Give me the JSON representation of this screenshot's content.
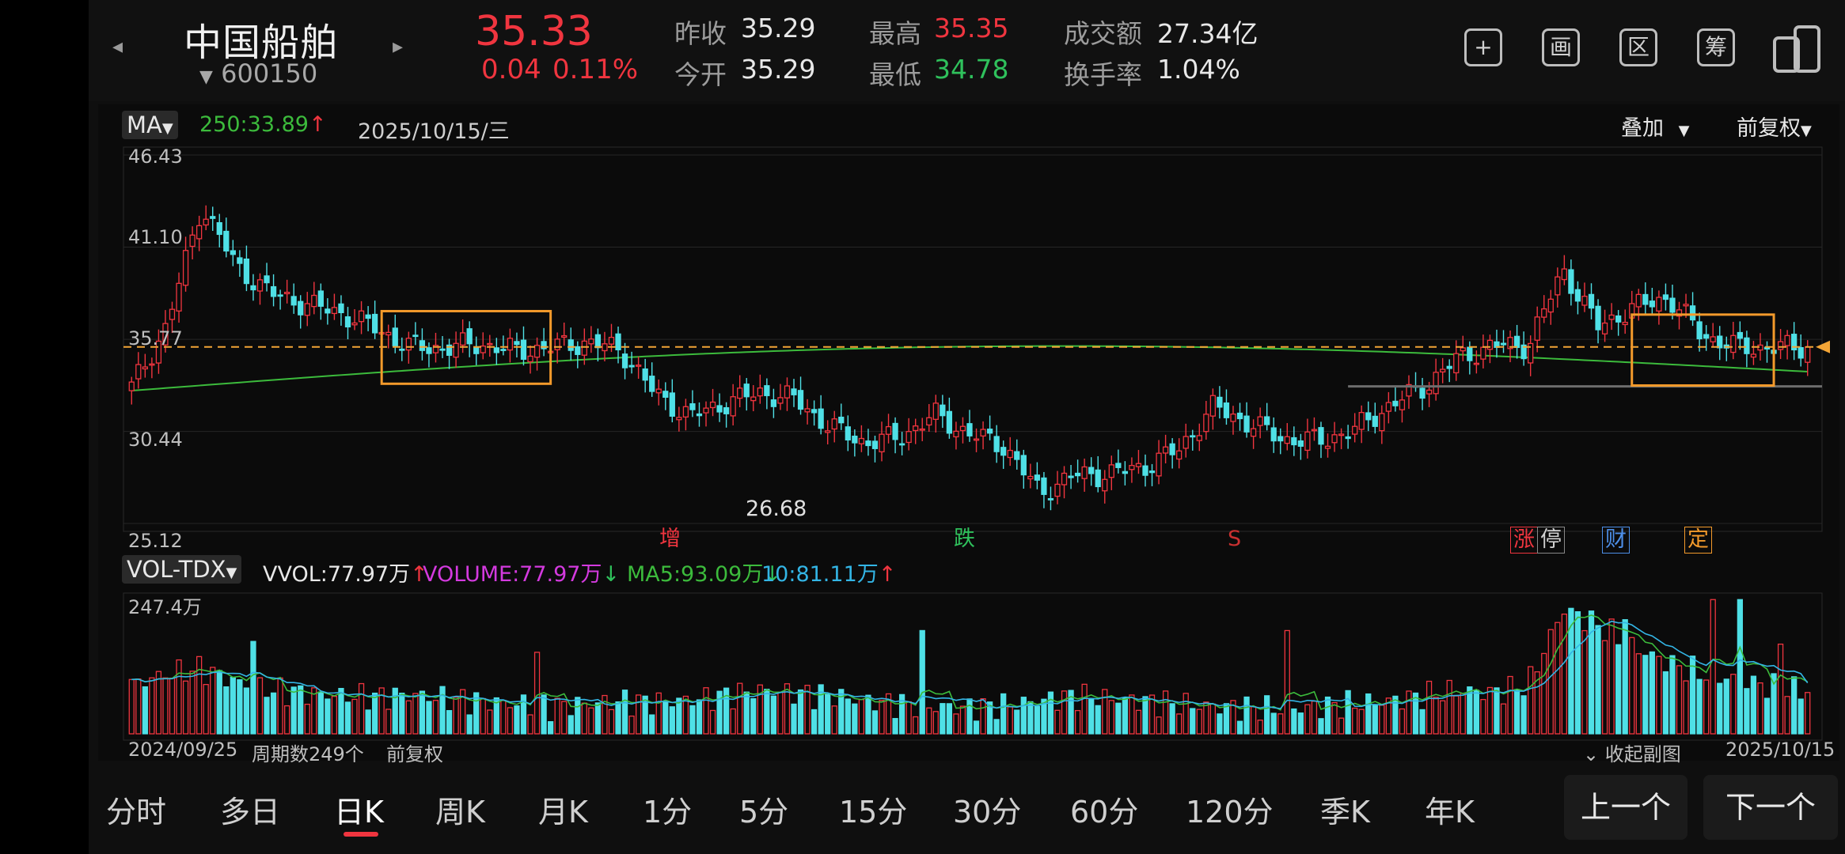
{
  "header": {
    "stock_name": "中国船舶",
    "stock_code": "600150",
    "price": "35.33",
    "change": "0.04",
    "change_pct": "0.11%",
    "prev_close_label": "昨收",
    "prev_close": "35.29",
    "open_label": "今开",
    "open": "35.29",
    "high_label": "最高",
    "high": "35.35",
    "low_label": "最低",
    "low": "34.78",
    "turnover_amount_label": "成交额",
    "turnover_amount": "27.34亿",
    "turnover_rate_label": "换手率",
    "turnover_rate": "1.04%"
  },
  "toolbar": {
    "icons": [
      "plus-icon",
      "draw-icon",
      "region-icon",
      "chip-icon",
      "device-switch-icon"
    ],
    "glyphs": [
      "+",
      "画",
      "区",
      "筹",
      ""
    ]
  },
  "main_chart": {
    "indicator_button": "MA",
    "ma_label": "250:",
    "ma_value": "33.89",
    "ma_arrow": "↑",
    "date": "2025/10/15/三",
    "overlay_button": "叠加",
    "adjust_button": "前复权",
    "y_ticks": [
      "46.43",
      "41.10",
      "35.77",
      "30.44",
      "25.12"
    ],
    "low_annotation": "26.68",
    "event_markers": [
      "增",
      "跌",
      "S",
      "涨",
      "停",
      "财",
      "定"
    ],
    "colors": {
      "up": "#f0353f",
      "down": "#4fe0e6",
      "ma250": "#3cbb3c",
      "highlight": "#f39a2b",
      "price_line": "#f3a536"
    }
  },
  "volume_chart": {
    "indicator_button": "VOL-TDX",
    "vvol_label": "VVOL:",
    "vvol": "77.97万",
    "vvol_arrow": "↑",
    "volume_label": "VOLUME:",
    "volume": "77.97万",
    "volume_arrow": "↓",
    "ma5_label": "MA5:",
    "ma5": "93.09万",
    "ma5_arrow": "↓",
    "ma10_label": "10:",
    "ma10": "81.11万",
    "ma10_arrow": "↑",
    "y_top": "247.4万",
    "start_date": "2024/09/25",
    "period_count": "周期数249个",
    "adjust": "前复权",
    "collapse": "收起副图",
    "end_date": "2025/10/15"
  },
  "timeframes": [
    "分时",
    "多日",
    "日K",
    "周K",
    "月K",
    "1分",
    "5分",
    "15分",
    "30分",
    "60分",
    "120分",
    "季K",
    "年K"
  ],
  "active_timeframe": "日K",
  "pager": {
    "prev": "上一个",
    "next": "下一个"
  },
  "chart_data": {
    "type": "candlestick",
    "ylim": [
      25.12,
      46.43
    ],
    "start_date": "2024/09/25",
    "end_date": "2025/10/15",
    "period_count": 249,
    "anchor_closes": [
      33.0,
      36.5,
      43.5,
      40.0,
      38.4,
      37.8,
      37.3,
      36.4,
      35.3,
      35.3,
      35.5,
      35.1,
      35.3,
      35.6,
      35.2,
      32.6,
      31.3,
      32.1,
      32.7,
      32.3,
      30.7,
      29.8,
      30.1,
      31.4,
      30.3,
      29.6,
      26.9,
      27.9,
      28.0,
      28.4,
      29.4,
      31.9,
      30.9,
      30.0,
      29.9,
      30.5,
      31.9,
      33.0,
      34.7,
      35.4,
      35.4,
      39.8,
      36.5,
      37.6,
      38.2,
      36.0,
      35.3,
      35.3,
      35.3
    ],
    "ma250_start": 32.8,
    "ma250_end": 33.9,
    "volume_ylim": [
      0,
      247.4
    ],
    "volume_anchor": [
      90,
      110,
      120,
      95,
      80,
      75,
      70,
      68,
      72,
      65,
      60,
      55,
      50,
      55,
      60,
      58,
      62,
      70,
      80,
      75,
      70,
      60,
      55,
      50,
      48,
      52,
      60,
      70,
      65,
      60,
      55,
      50,
      48,
      45,
      50,
      55,
      60,
      70,
      80,
      75,
      90,
      230,
      200,
      160,
      130,
      110,
      100,
      85,
      78
    ],
    "volume_highlights": [
      [
        18,
        170
      ],
      [
        60,
        150
      ],
      [
        117,
        190
      ],
      [
        171,
        190
      ],
      [
        221,
        210
      ],
      [
        234,
        247
      ],
      [
        238,
        247
      ],
      [
        244,
        165
      ]
    ]
  }
}
